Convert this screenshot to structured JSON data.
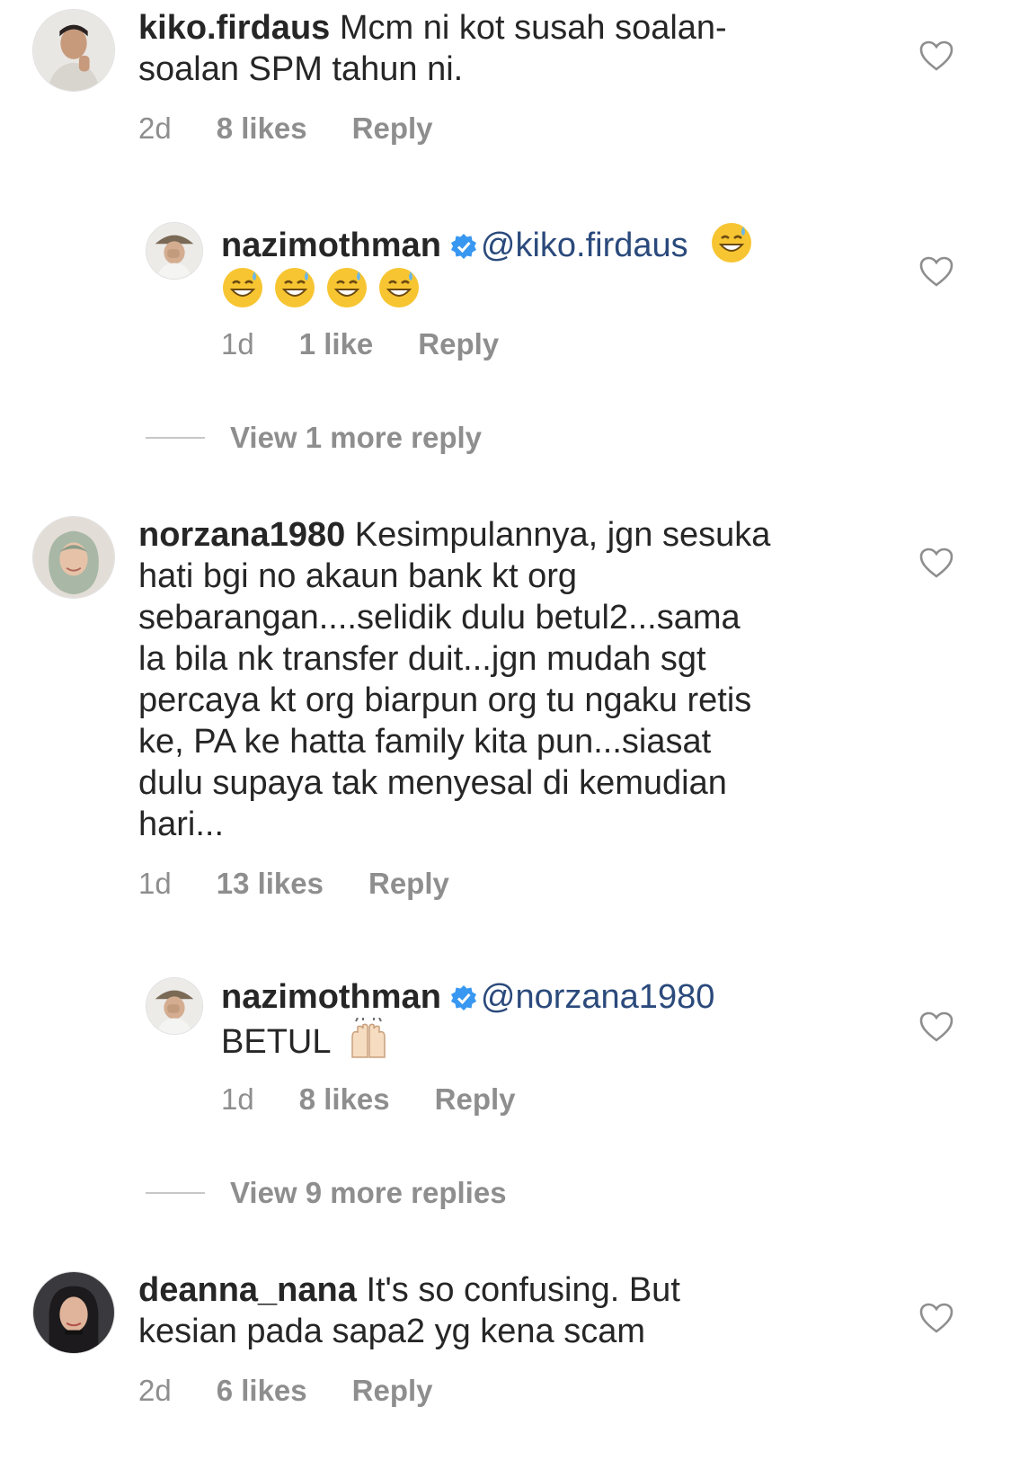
{
  "comments": [
    {
      "username": "kiko.firdaus",
      "text": "Mcm ni kot susah soalan-",
      "text2": "soalan SPM tahun ni.",
      "time": "2d",
      "likes": "8 likes",
      "reply": "Reply"
    },
    {
      "username": "nazimothman",
      "mention": "@kiko.firdaus",
      "time": "1d",
      "likes": "1 like",
      "reply": "Reply"
    },
    {
      "view_more": "View 1 more reply"
    },
    {
      "username": "norzana1980",
      "lines": [
        "Kesimpulannya, jgn sesuka",
        "hati bgi no akaun bank kt org",
        "sebarangan....selidik dulu betul2...sama",
        "la bila nk transfer duit...jgn mudah sgt",
        "percaya kt org biarpun org tu ngaku retis",
        "ke, PA ke hatta family kita pun...siasat",
        "dulu supaya tak menyesal di kemudian",
        "hari..."
      ],
      "time": "1d",
      "likes": "13 likes",
      "reply": "Reply"
    },
    {
      "username": "nazimothman",
      "mention": "@norzana1980",
      "text": "BETUL",
      "time": "1d",
      "likes": "8 likes",
      "reply": "Reply"
    },
    {
      "view_more": "View 9 more replies"
    },
    {
      "username": "deanna_nana",
      "text": "It's so confusing. But",
      "text2": "kesian pada sapa2 yg kena scam",
      "time": "2d",
      "likes": "6 likes",
      "reply": "Reply"
    }
  ],
  "colors": {
    "text": "#262626",
    "meta": "#8e8e8e",
    "mention": "#2b4a7c",
    "verified": "#3897f0"
  },
  "icons": {
    "heart": "heart-outline-icon",
    "verified": "verified-badge-icon",
    "emoji_sweat": "grinning-sweat-emoji",
    "emoji_hands": "raising-hands-emoji"
  }
}
